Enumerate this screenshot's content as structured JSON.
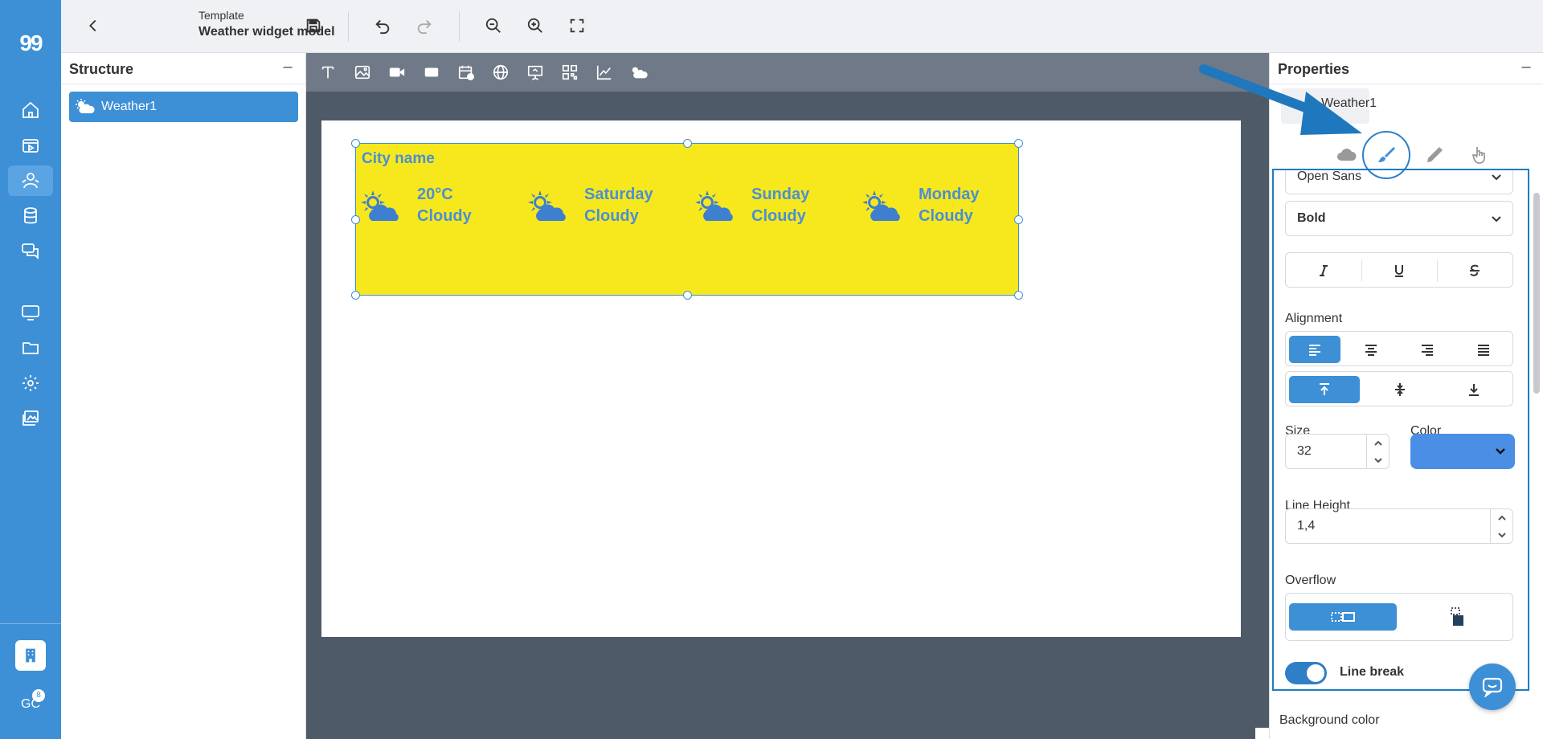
{
  "nav": {
    "logo": "99",
    "items": [
      "home-icon",
      "media-icon",
      "users-icon",
      "database-icon",
      "messages-icon",
      "screen-icon",
      "folder-icon",
      "settings-icon",
      "gallery-icon"
    ],
    "active": "users-icon",
    "user_initials": "GC",
    "user_badge": "8"
  },
  "topbar": {
    "doc_type": "Template",
    "doc_name": "Weather widget model"
  },
  "structure": {
    "title": "Structure",
    "items": [
      {
        "label": "Weather1"
      }
    ]
  },
  "toolbox": {
    "tools": [
      "text-tool-icon",
      "image-tool-icon",
      "video-tool-icon",
      "shape-tool-icon",
      "calendar-tool-icon",
      "web-tool-icon",
      "presentation-tool-icon",
      "qr-tool-icon",
      "chart-tool-icon",
      "weather-tool-icon"
    ]
  },
  "widget": {
    "city": "City name",
    "text_color": "#4a8fd4",
    "background": "#f7e81e",
    "days": [
      {
        "line1": "20°C",
        "line2": "Cloudy"
      },
      {
        "line1": "Saturday",
        "line2": "Cloudy"
      },
      {
        "line1": "Sunday",
        "line2": "Cloudy"
      },
      {
        "line1": "Monday",
        "line2": "Cloudy"
      }
    ]
  },
  "properties": {
    "title": "Properties",
    "object_name": "Weather1",
    "object_type": "box",
    "tabs": [
      "data-cloud-icon",
      "style-brush-icon",
      "edit-pencil-icon",
      "action-hand-icon"
    ],
    "active_tab": "style-brush-icon",
    "font_family": "Open Sans",
    "font_weight": "Bold",
    "alignment_label": "Alignment",
    "size_label": "Size",
    "size_value": "32",
    "color_label": "Color",
    "color_value": "#4a8ee6",
    "line_height_label": "Line Height",
    "line_height_value": "1,4",
    "overflow_label": "Overflow",
    "line_break_label": "Line break",
    "line_break_on": true,
    "background_color_label": "Background color"
  },
  "accent": "#3d8fd6"
}
